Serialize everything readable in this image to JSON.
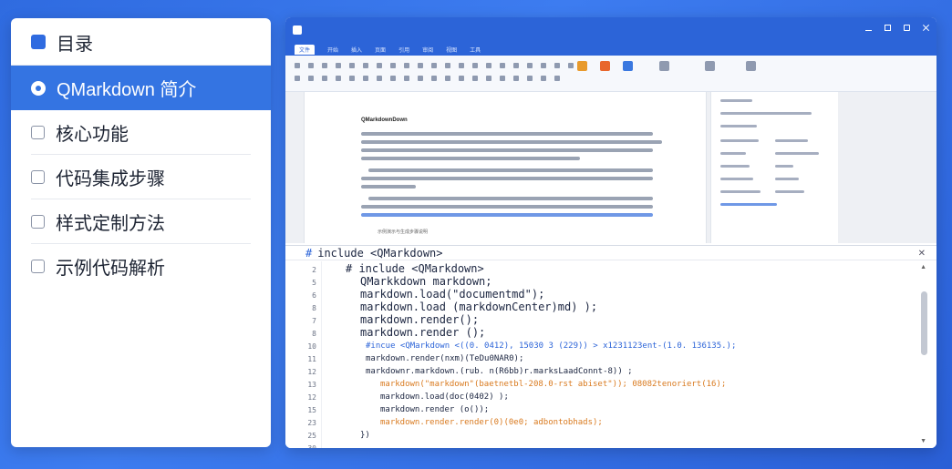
{
  "toc": {
    "items": [
      {
        "label": "目录",
        "icon": "book-icon"
      },
      {
        "label": "QMarkdown 简介",
        "icon": "radio-dot-icon"
      },
      {
        "label": "核心功能",
        "icon": "checkbox-icon"
      },
      {
        "label": "代码集成步骤",
        "icon": "grid-icon"
      },
      {
        "label": "样式定制方法",
        "icon": "checkbox-icon"
      },
      {
        "label": "示例代码解析",
        "icon": "checkbox-icon"
      }
    ],
    "active_index": 1
  },
  "window": {
    "menu": [
      "文件",
      "开始",
      "插入",
      "页面",
      "引用",
      "审阅",
      "视图",
      "工具"
    ],
    "active_menu_index": 0
  },
  "document": {
    "heading": "QMarkdownDown",
    "caption": "示例演示与生成步骤说明"
  },
  "editor": {
    "header_code": "include <QMarkdown>",
    "lines": [
      {
        "num": "2",
        "text": "# include  <QMarkdown>"
      },
      {
        "num": "5",
        "text": "QMarkkdown markdown;"
      },
      {
        "num": "6",
        "text": "markdown.load(\"documentmd\");"
      },
      {
        "num": "8",
        "text": "markdown.load (markdownCenter)md) );"
      },
      {
        "num": "7",
        "text": "markdown.render();"
      },
      {
        "num": "8",
        "text": "markdown.render ();"
      },
      {
        "num": "10",
        "text": "#incue <QMarkdown <((0. 0412), 15030 3 (229)) > x1231123ent-(1.0. 136135.);"
      },
      {
        "num": "11",
        "text": "markdown.render(nxm)(TeDu0NAR0);"
      },
      {
        "num": "12",
        "text": "markdownr.markdown.(rub. n(R6bb)r.marksLaadConnt-8)) ;"
      },
      {
        "num": "13",
        "text": "markdown(\"markdown\"(baetnetbl-208.0-rst abiset\")); 08082tenoriert(16);"
      },
      {
        "num": "12",
        "text": "markdown.load(doc(0402) );"
      },
      {
        "num": "15",
        "text": "markdown.render (o());"
      },
      {
        "num": "23",
        "text": "markdown.render.render(0)(0e0;  adbontobhads);"
      },
      {
        "num": "25",
        "text": "})"
      },
      {
        "num": "30",
        "text": ""
      }
    ]
  }
}
